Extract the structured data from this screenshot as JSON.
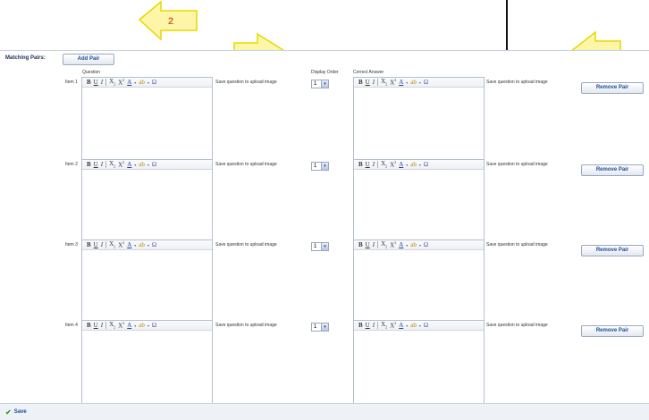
{
  "callout": {
    "step": "2"
  },
  "form": {
    "label": "Matching Pairs:",
    "add_pair": "Add Pair",
    "headers": {
      "question": "Question",
      "display_order": "Display Order",
      "correct_answer": "Correct Answer"
    },
    "toolbar": {
      "bold": "B",
      "underline": "U",
      "italic": "I",
      "subscript": "X",
      "sub": "2",
      "superscript": "X",
      "sup": "2",
      "font_color": "A",
      "highlight": "ab",
      "omega": "Ω"
    },
    "upload_note": "Save question to upload image",
    "remove_pair": "Remove Pair",
    "items": [
      {
        "label": "Item 1",
        "order": "1"
      },
      {
        "label": "Item 2",
        "order": "1"
      },
      {
        "label": "Item 3",
        "order": "1"
      },
      {
        "label": "Item 4",
        "order": "1"
      }
    ]
  },
  "footer": {
    "save": "Save"
  },
  "colors": {
    "accent": "#1c4a9a",
    "callout_fill": "#fdf6a8",
    "callout_stroke": "#e6d800",
    "callout_text": "#d9662a",
    "save_check": "#3a9a2a"
  }
}
